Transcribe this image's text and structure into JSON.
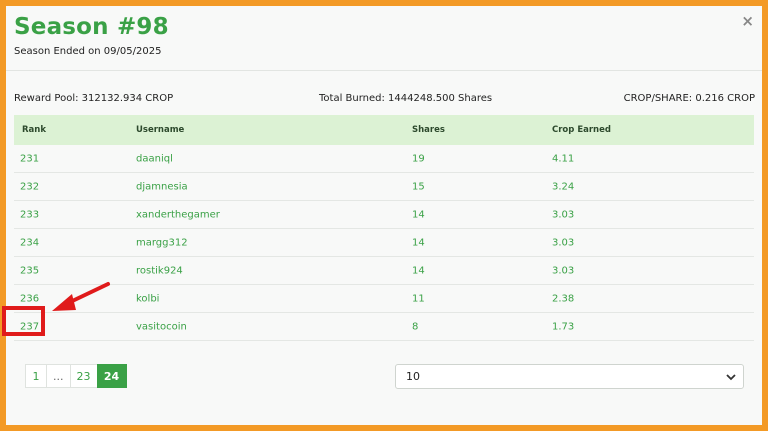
{
  "header": {
    "title": "Season #98",
    "subtitle": "Season Ended on 09/05/2025",
    "close_icon": "×"
  },
  "stats": {
    "reward_pool": "Reward Pool: 312132.934 CROP",
    "total_burned": "Total Burned: 1444248.500 Shares",
    "crop_per_share": "CROP/SHARE: 0.216 CROP"
  },
  "table": {
    "headers": [
      "Rank",
      "Username",
      "Shares",
      "Crop Earned"
    ],
    "rows": [
      [
        "231",
        "daaniql",
        "19",
        "4.11"
      ],
      [
        "232",
        "djamnesia",
        "15",
        "3.24"
      ],
      [
        "233",
        "xanderthegamer",
        "14",
        "3.03"
      ],
      [
        "234",
        "margg312",
        "14",
        "3.03"
      ],
      [
        "235",
        "rostik924",
        "14",
        "3.03"
      ],
      [
        "236",
        "kolbi",
        "11",
        "2.38"
      ],
      [
        "237",
        "vasitocoin",
        "8",
        "1.73"
      ]
    ]
  },
  "pagination": {
    "pages": [
      "1",
      "...",
      "23",
      "24"
    ],
    "active": "24"
  },
  "page_size": {
    "selected": "10"
  },
  "colors": {
    "frame": "#f39a26",
    "accent": "#3aa146",
    "header_bg": "#dcf2d4",
    "highlight": "#e01b1b"
  },
  "annotation": {
    "icons": [
      "red-arrow-icon",
      "highlight-box"
    ]
  }
}
